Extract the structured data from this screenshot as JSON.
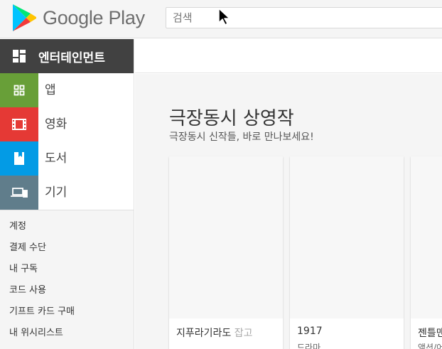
{
  "brand": {
    "name": "Google Play"
  },
  "search": {
    "placeholder": "검색"
  },
  "sidebar": {
    "section": "엔터테인먼트",
    "categories": [
      {
        "label": "앱",
        "color": "#689f38",
        "icon": "apps-grid-icon"
      },
      {
        "label": "영화",
        "color": "#e53935",
        "icon": "film-icon"
      },
      {
        "label": "도서",
        "color": "#039be5",
        "icon": "book-icon"
      },
      {
        "label": "기기",
        "color": "#607d8b",
        "icon": "devices-icon"
      }
    ],
    "links": [
      "계정",
      "결제 수단",
      "내 구독",
      "코드 사용",
      "기프트 카드 구매",
      "내 위시리스트"
    ]
  },
  "main": {
    "title": "극장동시 상영작",
    "subtitle": "극장동시 신작들, 바로 만나보세요!",
    "cards": [
      {
        "title_main": "지푸라기라도",
        "title_fade": " 잡고",
        "genre": ""
      },
      {
        "title_main": "1917",
        "title_fade": "",
        "genre": "드라마"
      },
      {
        "title_main": "젠틀맨",
        "title_fade": "",
        "genre": "액션/어드벤처"
      }
    ]
  },
  "colors": {
    "entertainment_bg": "#414141",
    "page_bg": "#f5f5f5"
  }
}
